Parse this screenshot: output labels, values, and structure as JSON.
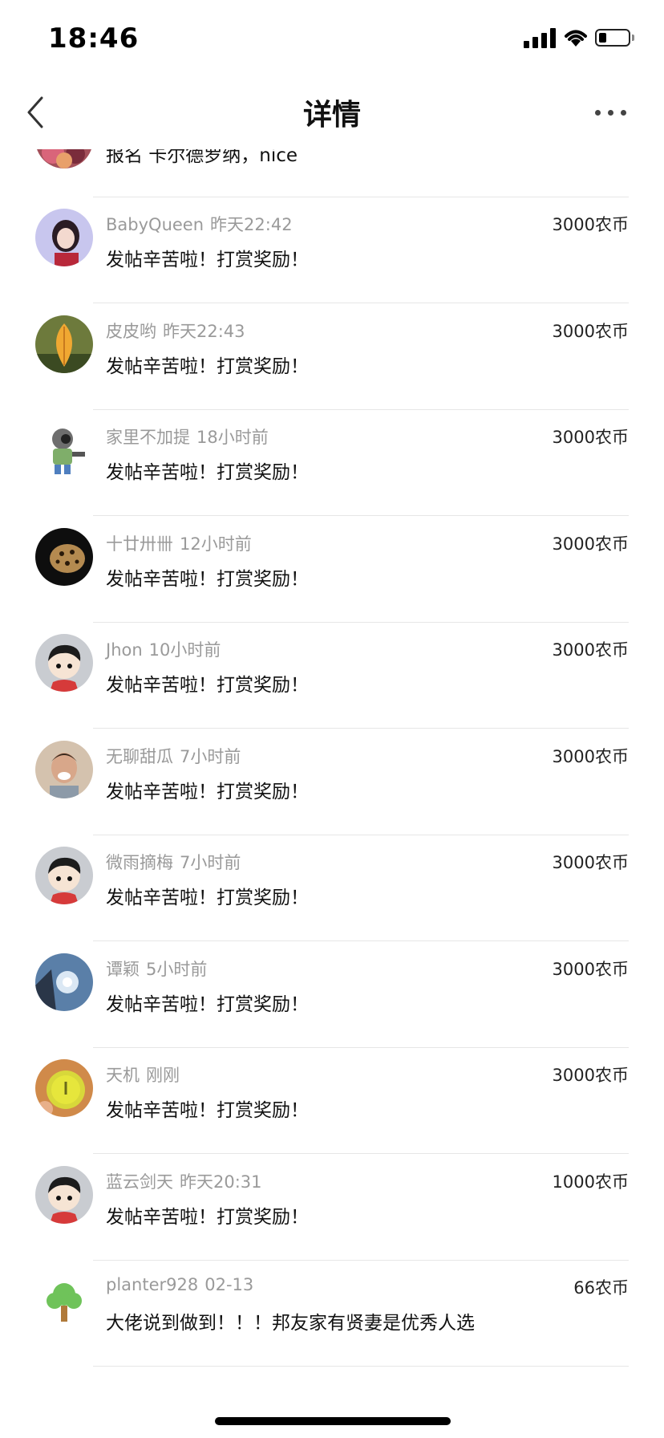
{
  "status_bar": {
    "time": "18:46"
  },
  "nav": {
    "title": "详情"
  },
  "partial_row": {
    "message": "报名 卡尔德罗纳，nice"
  },
  "rewards": [
    {
      "user": "BabyQueen",
      "time": "昨天22:42",
      "amount": "3000农币",
      "message": "发帖辛苦啦！打赏奖励！",
      "avatar": "girl-avatar"
    },
    {
      "user": "皮皮哟",
      "time": "昨天22:43",
      "amount": "3000农币",
      "message": "发帖辛苦啦！打赏奖励！",
      "avatar": "leaf-avatar"
    },
    {
      "user": "家里不加提",
      "time": "18小时前",
      "amount": "3000农币",
      "message": "发帖辛苦啦！打赏奖励！",
      "avatar": "robot-avatar"
    },
    {
      "user": "十廿卅卌",
      "time": "12小时前",
      "amount": "3000农币",
      "message": "发帖辛苦啦！打赏奖励！",
      "avatar": "leopard-avatar"
    },
    {
      "user": "Jhon",
      "time": "10小时前",
      "amount": "3000农币",
      "message": "发帖辛苦啦！打赏奖励！",
      "avatar": "cartoon-avatar"
    },
    {
      "user": "无聊甜瓜",
      "time": "7小时前",
      "amount": "3000农币",
      "message": "发帖辛苦啦！打赏奖励！",
      "avatar": "man-avatar"
    },
    {
      "user": "微雨摘梅",
      "time": "7小时前",
      "amount": "3000农币",
      "message": "发帖辛苦啦！打赏奖励！",
      "avatar": "cartoon-avatar"
    },
    {
      "user": "谭颖",
      "time": "5小时前",
      "amount": "3000农币",
      "message": "发帖辛苦啦！打赏奖励！",
      "avatar": "sky-avatar"
    },
    {
      "user": "天机",
      "time": "刚刚",
      "amount": "3000农币",
      "message": "发帖辛苦啦！打赏奖励！",
      "avatar": "fruit-avatar"
    },
    {
      "user": "蓝云剑天",
      "time": "昨天20:31",
      "amount": "1000农币",
      "message": "发帖辛苦啦！打赏奖励！",
      "avatar": "cartoon-avatar"
    },
    {
      "user": "planter928",
      "time": "02-13",
      "amount": "66农币",
      "message": "大佬说到做到！！！邦友家有贤妻是优秀人选",
      "avatar": "tree-avatar"
    }
  ]
}
